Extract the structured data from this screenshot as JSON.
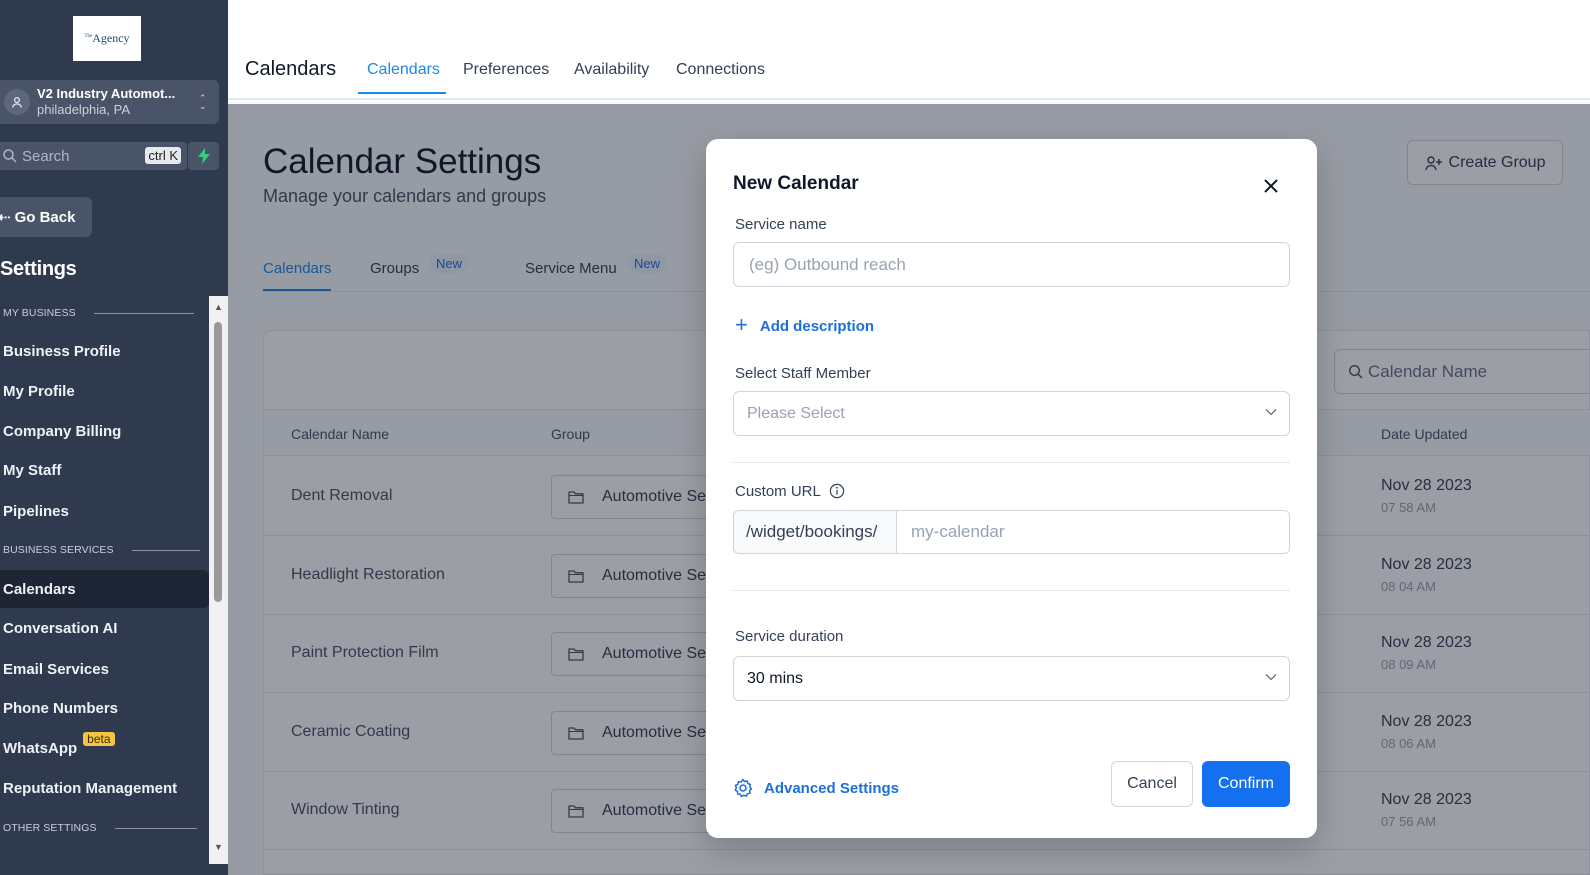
{
  "sidebar": {
    "logo_text": "Agency",
    "logo_sup": "The",
    "account_name": "V2 Industry Automot...",
    "account_location": "philadelphia, PA",
    "search_placeholder": "Search",
    "search_shortcut": "ctrl K",
    "go_back": "Go Back",
    "settings_title": "Settings",
    "sections": {
      "my_business": "MY BUSINESS",
      "business_services": "BUSINESS SERVICES",
      "other_settings": "OTHER SETTINGS"
    },
    "items": {
      "business_profile": "Business Profile",
      "my_profile": "My Profile",
      "company_billing": "Company Billing",
      "my_staff": "My Staff",
      "pipelines": "Pipelines",
      "calendars": "Calendars",
      "conversation_ai": "Conversation AI",
      "email_services": "Email Services",
      "phone_numbers": "Phone Numbers",
      "whatsapp": "WhatsApp",
      "whatsapp_badge": "beta",
      "reputation_management": "Reputation Management"
    }
  },
  "topnav": {
    "title": "Calendars",
    "tabs": [
      "Calendars",
      "Preferences",
      "Availability",
      "Connections"
    ],
    "active_tab": "Calendars"
  },
  "main": {
    "title": "Calendar Settings",
    "subtitle": "Manage your calendars and groups",
    "create_group": "Create Group",
    "tabs": {
      "calendars": "Calendars",
      "groups": "Groups",
      "service_menu": "Service Menu",
      "new_badge": "New"
    },
    "search_placeholder": "Calendar Name",
    "table": {
      "headers": {
        "name": "Calendar Name",
        "group": "Group",
        "date_updated": "Date Updated"
      },
      "rows": [
        {
          "name": "Dent Removal",
          "group": "Automotive Services",
          "date": "Nov 28 2023",
          "time": "07 58 AM"
        },
        {
          "name": "Headlight Restoration",
          "group": "Automotive Services",
          "date": "Nov 28 2023",
          "time": "08 04 AM"
        },
        {
          "name": "Paint Protection Film",
          "group": "Automotive Services",
          "date": "Nov 28 2023",
          "time": "08 09 AM"
        },
        {
          "name": "Ceramic Coating",
          "group": "Automotive Services",
          "date": "Nov 28 2023",
          "time": "08 06 AM"
        },
        {
          "name": "Window Tinting",
          "group": "Automotive Services",
          "date": "Nov 28 2023",
          "time": "07 56 AM"
        }
      ]
    }
  },
  "modal": {
    "title": "New Calendar",
    "service_name_label": "Service name",
    "service_name_placeholder": "(eg) Outbound reach",
    "add_description": "Add description",
    "staff_label": "Select Staff Member",
    "staff_placeholder": "Please Select",
    "custom_url_label": "Custom URL",
    "url_prefix": "/widget/bookings/",
    "url_placeholder": "my-calendar",
    "duration_label": "Service duration",
    "duration_value": "30 mins",
    "advanced_settings": "Advanced Settings",
    "cancel": "Cancel",
    "confirm": "Confirm"
  },
  "colors": {
    "sidebar_bg": "#2f3a4f",
    "accent": "#1e88e5",
    "primary_button": "#1570ef",
    "beta_badge": "#f5c542"
  }
}
